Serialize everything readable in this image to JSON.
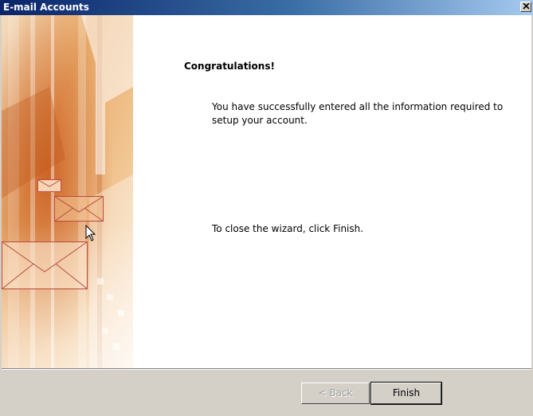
{
  "window": {
    "title": "E-mail Accounts"
  },
  "content": {
    "heading": "Congratulations!",
    "message": "You have successfully entered all the information required to setup your account.",
    "close_hint": "To close the wizard, click Finish."
  },
  "buttons": {
    "back_label": "< Back",
    "finish_label": "Finish"
  },
  "colors": {
    "titlebar_start": "#0a246a",
    "titlebar_end": "#a6caf0",
    "dialog_face": "#d4d0c8",
    "banner_orange": "#d2691e"
  },
  "icons": {
    "close": "close-icon",
    "envelope": "envelope-icon",
    "cursor": "mouse-cursor-icon"
  }
}
